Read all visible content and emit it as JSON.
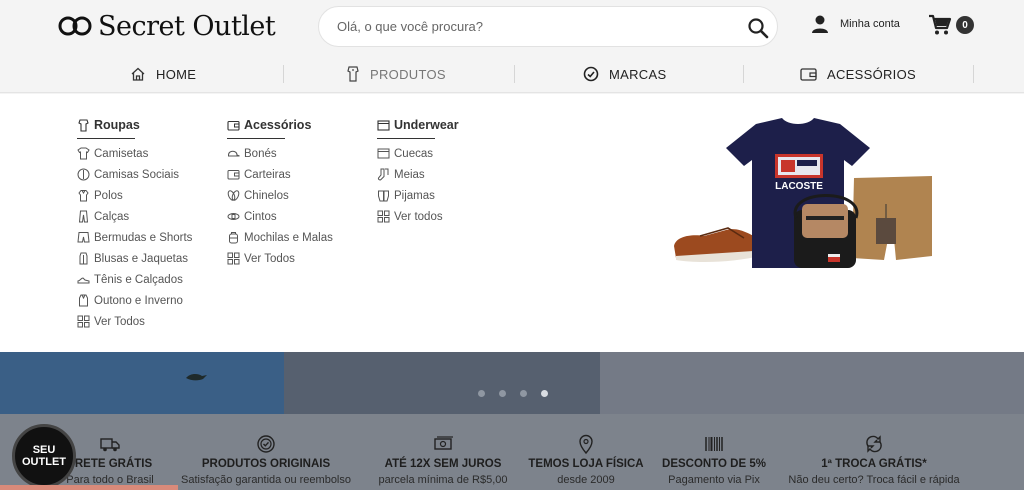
{
  "header": {
    "logo_text": "Secret Outlet",
    "search_placeholder": "Olá, o que você procura?",
    "account_label": "Minha conta",
    "cart_count": "0"
  },
  "nav": {
    "items": [
      {
        "label": "HOME",
        "icon": "home-icon"
      },
      {
        "label": "PRODUTOS",
        "icon": "shirt-icon"
      },
      {
        "label": "MARCAS",
        "icon": "brand-icon"
      },
      {
        "label": "ACESSÓRIOS",
        "icon": "wallet-icon"
      }
    ]
  },
  "menu": {
    "roupas": {
      "title": "Roupas",
      "items": [
        "Camisetas",
        "Camisas Sociais",
        "Polos",
        "Calças",
        "Bermudas e Shorts",
        "Blusas e Jaquetas",
        "Tênis e Calçados",
        "Outono e Inverno",
        "Ver Todos"
      ]
    },
    "acessorios": {
      "title": "Acessórios",
      "items": [
        "Bonés",
        "Carteiras",
        "Chinelos",
        "Cintos",
        "Mochilas e Malas",
        "Ver Todos"
      ]
    },
    "underwear": {
      "title": "Underwear",
      "items": [
        "Cuecas",
        "Meias",
        "Pijamas",
        "Ver todos"
      ]
    },
    "product_shirt_text": "LACOSTE"
  },
  "benefits": [
    {
      "title": "FRETE GRÁTIS",
      "subtitle": "Para todo o Brasil",
      "icon": "truck-icon"
    },
    {
      "title": "PRODUTOS ORIGINAIS",
      "subtitle": "Satisfação garantida ou reembolso",
      "icon": "badge-check-icon"
    },
    {
      "title": "ATÉ 12X SEM JUROS",
      "subtitle": "parcela mínima de R$5,00",
      "icon": "money-icon"
    },
    {
      "title": "TEMOS LOJA FÍSICA",
      "subtitle": "desde 2009",
      "icon": "location-pin-icon"
    },
    {
      "title": "DESCONTO DE 5%",
      "subtitle": "Pagamento via Pix",
      "icon": "barcode-icon"
    },
    {
      "title": "1ª TROCA GRÁTIS*",
      "subtitle": "Não deu certo? Troca fácil e rápida",
      "icon": "exchange-icon"
    }
  ],
  "seal": {
    "text": "SEU OUTLET"
  },
  "colors": {
    "overlay": "#7d838c",
    "accent": "#333333"
  }
}
